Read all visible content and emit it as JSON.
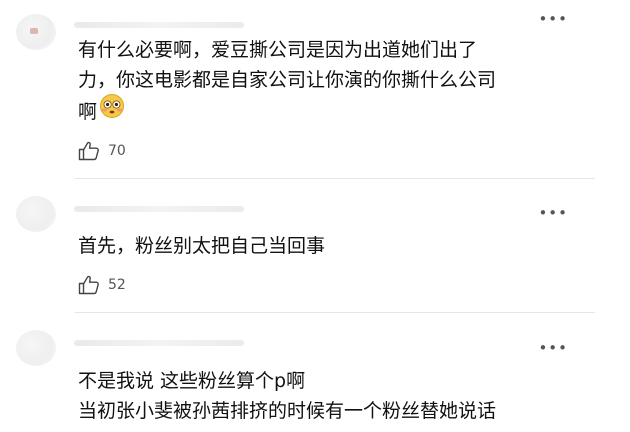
{
  "comments": [
    {
      "lines": [
        "有什么必要啊，爱豆撕公司是因为出道她们出了",
        "力，你这电影都是自家公司让你演的你撕什么公司",
        "啊"
      ],
      "emoji": "flushed-face-icon",
      "likes": "70",
      "more": "•••"
    },
    {
      "lines": [
        "首先，粉丝别太把自己当回事"
      ],
      "likes": "52",
      "more": "•••"
    },
    {
      "lines": [
        "不是我说 这些粉丝算个p啊",
        "当初张小斐被孙茜排挤的时候有一个粉丝替她说话"
      ],
      "more": "•••"
    }
  ],
  "colors": {
    "text": "#111111",
    "meta": "#555555",
    "divider": "#e6e6e6",
    "emoji_face": "#f7c948"
  }
}
